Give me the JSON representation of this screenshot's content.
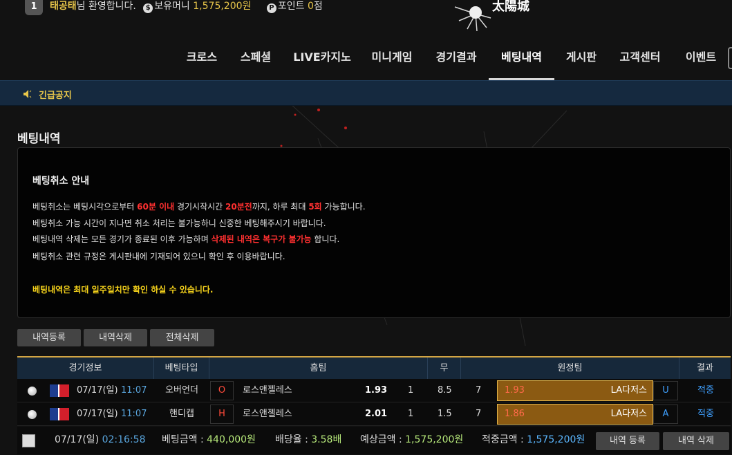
{
  "header": {
    "badge": "1",
    "username": "태공태",
    "welcome_suffix": "님 환영합니다.",
    "money_icon": "$",
    "money_label": "보유머니",
    "money_value": "1,575,200원",
    "point_icon": "P",
    "point_label": "포인트",
    "point_value": "0",
    "point_unit": "점",
    "logo_text": "太陽城"
  },
  "nav": {
    "items": [
      "크로스",
      "스페셜",
      "LIVE카지노",
      "미니게임",
      "경기결과",
      "베팅내역",
      "게시판",
      "고객센터",
      "이벤트"
    ],
    "active_index": 5
  },
  "notice": {
    "label": "긴급공지"
  },
  "page_title": "베팅내역",
  "info": {
    "title": "베팅취소 안내",
    "line1": {
      "a": "베팅취소는 베팅시각으로부터 ",
      "b": "60분 이내",
      "c": " 경기시작시간 ",
      "d": "20분전",
      "e": "까지, 하루 최대 ",
      "f": "5회",
      "g": " 가능합니다."
    },
    "line2": "베팅취소 가능 시간이 지나면 취소 처리는 불가능하니 신중한 베팅해주시기 바랍니다.",
    "line3": {
      "a": "베팅내역 삭제는 모든 경기가 종료된 이후 가능하며 ",
      "b": "삭제된 내역은 복구가 불가능",
      "c": " 합니다."
    },
    "line4": "베팅취소 관련 규정은 게시판내에 기재되어 있으니 확인 후 이용바랍니다.",
    "notice_yellow": "베팅내역은 최대 일주일치만 확인 하실 수 있습니다."
  },
  "buttons": {
    "register": "내역등록",
    "delete": "내역삭제",
    "delete_all": "전체삭제"
  },
  "table": {
    "headers": [
      "경기정보",
      "베팅타입",
      "홈팀",
      "무",
      "원정팀",
      "결과"
    ],
    "rows": [
      {
        "date": "07/17(일)",
        "time": "11:07",
        "bet_type": "오버언더",
        "home_sel": "O",
        "home_team": "로스앤젤레스",
        "home_odds": "1.93",
        "home_val": "1",
        "draw": "8.5",
        "draw_val": "7",
        "away_odds": "1.93",
        "away_team": "LA다저스",
        "away_sel": "U",
        "result": "적중"
      },
      {
        "date": "07/17(일)",
        "time": "11:07",
        "bet_type": "핸디캡",
        "home_sel": "H",
        "home_team": "로스앤젤레스",
        "home_odds": "2.01",
        "home_val": "1",
        "draw": "1.5",
        "draw_val": "7",
        "away_odds": "1.86",
        "away_team": "LA다저스",
        "away_sel": "A",
        "result": "적중"
      }
    ]
  },
  "summary": {
    "date": "07/17(일)",
    "time": "02:16:58",
    "bet_label": "베팅금액 : ",
    "bet_value": "440,000원",
    "rate_label": "배당율 : ",
    "rate_value": "3.58배",
    "expected_label": "예상금액 : ",
    "expected_value": "1,575,200원",
    "win_label": "적중금액 : ",
    "win_value": "1,575,200원",
    "btn_register": "내역 등록",
    "btn_delete": "내역 삭제"
  },
  "colors": {
    "accent": "#e8c64a",
    "red": "#ff3030",
    "blue": "#3fa0ff",
    "green": "#b6e87a",
    "away_box": "#8b5a12"
  }
}
